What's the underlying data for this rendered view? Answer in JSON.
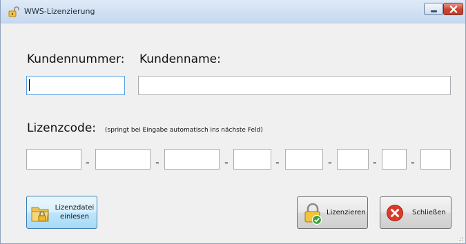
{
  "window": {
    "title": "WWS-Lizenzierung",
    "icon": "lock-open-icon"
  },
  "form": {
    "customer_number_label": "Kundennummer:",
    "customer_name_label": "Kundenname:",
    "customer_number_value": "",
    "customer_name_value": "",
    "license_code_label": "Lizenzcode:",
    "license_code_hint": "(springt bei Eingabe automatisch ins nächste Feld)",
    "license_segments": [
      "",
      "",
      "",
      "",
      "",
      "",
      "",
      ""
    ],
    "separator": "-"
  },
  "buttons": {
    "read_file_line1": "Lizenzdatei",
    "read_file_line2": "einlesen",
    "license": "Lizenzieren",
    "close": "Schließen"
  },
  "colors": {
    "titlebar": "#d3e2f3",
    "close_button": "#c94230",
    "hover_button": "#bee6fd"
  }
}
